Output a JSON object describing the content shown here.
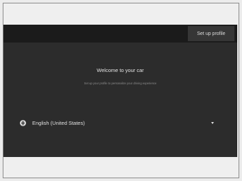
{
  "header": {
    "setup_profile_label": "Set up profile"
  },
  "welcome": {
    "title": "Welcome to your car",
    "subtitle": "Set up your profile to personalize your driving experience"
  },
  "language": {
    "selected": "English (United States)",
    "icon": "globe-icon"
  }
}
